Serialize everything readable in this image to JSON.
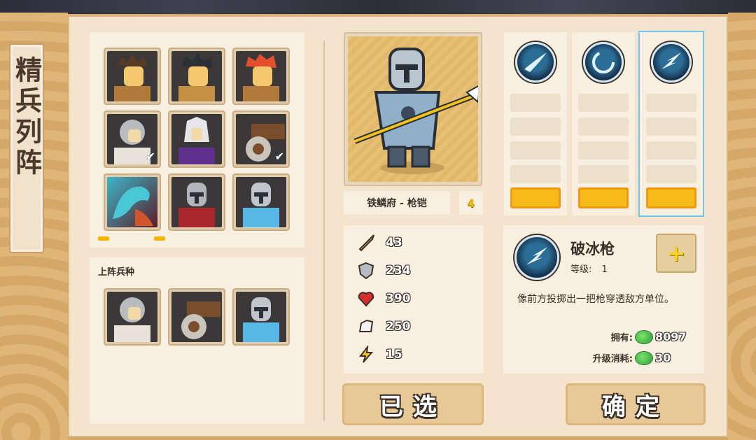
{
  "title": "精兵列阵",
  "roster": {
    "units": [
      {
        "name": "unit-brown-warrior",
        "checked": false
      },
      {
        "name": "unit-dark-warrior",
        "checked": false
      },
      {
        "name": "unit-red-warrior",
        "checked": false
      },
      {
        "name": "unit-grey-swordsman",
        "checked": true
      },
      {
        "name": "unit-purple-mage",
        "checked": false
      },
      {
        "name": "unit-shield-cart",
        "checked": true
      },
      {
        "name": "unit-teal-dragon",
        "checked": false
      },
      {
        "name": "unit-red-knight",
        "checked": false
      },
      {
        "name": "unit-blue-knight",
        "checked": false
      }
    ]
  },
  "lineup": {
    "label": "上阵兵种",
    "units": [
      "unit-grey-swordsman",
      "unit-shield-cart",
      "unit-blue-knight"
    ]
  },
  "selected_unit": {
    "name": "铁鳞府 - 枪铠",
    "level": "4"
  },
  "stats": {
    "attack": "43",
    "defense": "234",
    "health": "390",
    "speed": "250",
    "energy": "15"
  },
  "skills": [
    {
      "icon": "ice-slash-icon",
      "selected": false
    },
    {
      "icon": "ice-vortex-icon",
      "selected": false
    },
    {
      "icon": "ice-spear-icon",
      "selected": true
    }
  ],
  "skill_detail": {
    "name": "破冰枪",
    "level_label": "等级:",
    "level": "1",
    "plus": "+",
    "description": "像前方投掷出一把枪穿透敌方单位。",
    "own_label": "拥有:",
    "own_value": "8097",
    "cost_label": "升级消耗:",
    "cost_value": "30"
  },
  "buttons": {
    "selected": "已选",
    "confirm": "确定"
  },
  "colors": {
    "accent": "#f6bb1a",
    "selection": "#6ec8ee",
    "panel": "#f9efe1"
  }
}
